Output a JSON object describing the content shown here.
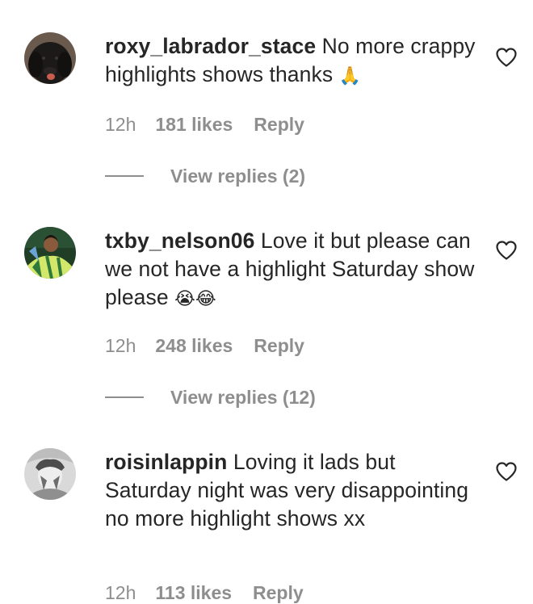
{
  "comments": [
    {
      "username": "roxy_labrador_stace",
      "text": " No more crappy highlights shows thanks ",
      "emoji": "🙏",
      "time": "12h",
      "likes": "181 likes",
      "reply": "Reply",
      "view_replies": "View replies (2)"
    },
    {
      "username": "txby_nelson06",
      "text": " Love it but please can we not have a highlight Saturday show please ",
      "emoji": "😭😂",
      "time": "12h",
      "likes": "248 likes",
      "reply": "Reply",
      "view_replies": "View replies (12)"
    },
    {
      "username": "roisinlappin",
      "text": " Loving it lads but Saturday night was very disappointing no more highlight shows xx",
      "emoji": "",
      "time": "12h",
      "likes": "113 likes",
      "reply": "Reply"
    }
  ],
  "icons": {
    "like": "heart-outline-icon",
    "avatar_1": "dog-avatar",
    "avatar_2": "football-player-avatar",
    "avatar_3": "person-avatar"
  },
  "colors": {
    "text": "#262626",
    "secondary": "#8e8e8e",
    "background": "#ffffff"
  }
}
